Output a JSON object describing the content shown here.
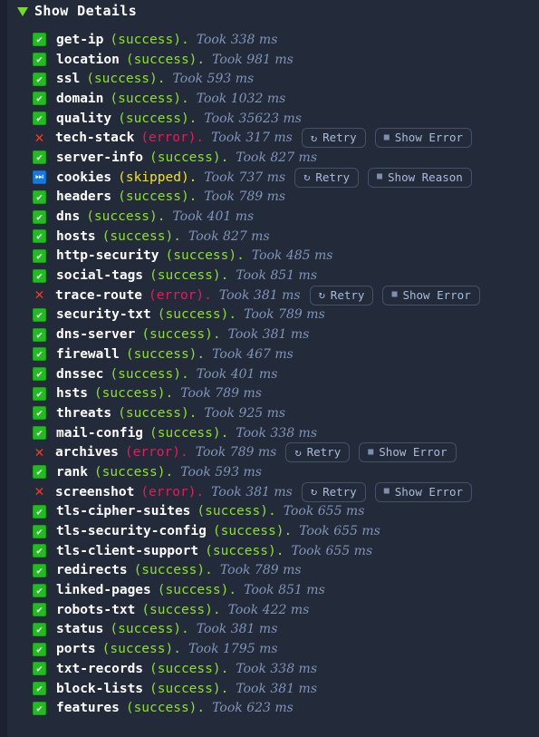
{
  "header": {
    "toggle_icon": "triangle-down-icon",
    "title": "Show Details"
  },
  "buttons": {
    "retry_label": "Retry",
    "retry_icon": "rotate-ccw-icon",
    "retry_glyph": "↻",
    "show_error_label": "Show Error",
    "show_reason_label": "Show Reason",
    "square_icon": "square-icon",
    "square_glyph": "■"
  },
  "colors": {
    "background": "#232a3a",
    "gutter": "#1b2130",
    "success": "#8ce02a",
    "error": "#e81a5c",
    "skipped": "#f2e515",
    "error_mark": "#e8412a",
    "badge_success_bg": "#22bb22",
    "badge_skipped_bg": "#1779e0",
    "took_text": "#8094b8",
    "name_text": "#ffffff",
    "button_border": "#45506b",
    "button_text": "#a9bbdb",
    "triangle": "#74dd23"
  },
  "jobs": [
    {
      "name": "get-ip",
      "status": "success",
      "status_label": "(success).",
      "took": "Took 338 ms",
      "actions": []
    },
    {
      "name": "location",
      "status": "success",
      "status_label": "(success).",
      "took": "Took 981 ms",
      "actions": []
    },
    {
      "name": "ssl",
      "status": "success",
      "status_label": "(success).",
      "took": "Took 593 ms",
      "actions": []
    },
    {
      "name": "domain",
      "status": "success",
      "status_label": "(success).",
      "took": "Took 1032 ms",
      "actions": []
    },
    {
      "name": "quality",
      "status": "success",
      "status_label": "(success).",
      "took": "Took 35623 ms",
      "actions": []
    },
    {
      "name": "tech-stack",
      "status": "error",
      "status_label": "(error).",
      "took": "Took 317 ms",
      "actions": [
        "Retry",
        "Show Error"
      ]
    },
    {
      "name": "server-info",
      "status": "success",
      "status_label": "(success).",
      "took": "Took 827 ms",
      "actions": []
    },
    {
      "name": "cookies",
      "status": "skipped",
      "status_label": "(skipped).",
      "took": "Took 737 ms",
      "actions": [
        "Retry",
        "Show Reason"
      ]
    },
    {
      "name": "headers",
      "status": "success",
      "status_label": "(success).",
      "took": "Took 789 ms",
      "actions": []
    },
    {
      "name": "dns",
      "status": "success",
      "status_label": "(success).",
      "took": "Took 401 ms",
      "actions": []
    },
    {
      "name": "hosts",
      "status": "success",
      "status_label": "(success).",
      "took": "Took 827 ms",
      "actions": []
    },
    {
      "name": "http-security",
      "status": "success",
      "status_label": "(success).",
      "took": "Took 485 ms",
      "actions": []
    },
    {
      "name": "social-tags",
      "status": "success",
      "status_label": "(success).",
      "took": "Took 851 ms",
      "actions": []
    },
    {
      "name": "trace-route",
      "status": "error",
      "status_label": "(error).",
      "took": "Took 381 ms",
      "actions": [
        "Retry",
        "Show Error"
      ]
    },
    {
      "name": "security-txt",
      "status": "success",
      "status_label": "(success).",
      "took": "Took 789 ms",
      "actions": []
    },
    {
      "name": "dns-server",
      "status": "success",
      "status_label": "(success).",
      "took": "Took 381 ms",
      "actions": []
    },
    {
      "name": "firewall",
      "status": "success",
      "status_label": "(success).",
      "took": "Took 467 ms",
      "actions": []
    },
    {
      "name": "dnssec",
      "status": "success",
      "status_label": "(success).",
      "took": "Took 401 ms",
      "actions": []
    },
    {
      "name": "hsts",
      "status": "success",
      "status_label": "(success).",
      "took": "Took 789 ms",
      "actions": []
    },
    {
      "name": "threats",
      "status": "success",
      "status_label": "(success).",
      "took": "Took 925 ms",
      "actions": []
    },
    {
      "name": "mail-config",
      "status": "success",
      "status_label": "(success).",
      "took": "Took 338 ms",
      "actions": []
    },
    {
      "name": "archives",
      "status": "error",
      "status_label": "(error).",
      "took": "Took 789 ms",
      "actions": [
        "Retry",
        "Show Error"
      ]
    },
    {
      "name": "rank",
      "status": "success",
      "status_label": "(success).",
      "took": "Took 593 ms",
      "actions": []
    },
    {
      "name": "screenshot",
      "status": "error",
      "status_label": "(error).",
      "took": "Took 381 ms",
      "actions": [
        "Retry",
        "Show Error"
      ]
    },
    {
      "name": "tls-cipher-suites",
      "status": "success",
      "status_label": "(success).",
      "took": "Took 655 ms",
      "actions": []
    },
    {
      "name": "tls-security-config",
      "status": "success",
      "status_label": "(success).",
      "took": "Took 655 ms",
      "actions": []
    },
    {
      "name": "tls-client-support",
      "status": "success",
      "status_label": "(success).",
      "took": "Took 655 ms",
      "actions": []
    },
    {
      "name": "redirects",
      "status": "success",
      "status_label": "(success).",
      "took": "Took 789 ms",
      "actions": []
    },
    {
      "name": "linked-pages",
      "status": "success",
      "status_label": "(success).",
      "took": "Took 851 ms",
      "actions": []
    },
    {
      "name": "robots-txt",
      "status": "success",
      "status_label": "(success).",
      "took": "Took 422 ms",
      "actions": []
    },
    {
      "name": "status",
      "status": "success",
      "status_label": "(success).",
      "took": "Took 381 ms",
      "actions": []
    },
    {
      "name": "ports",
      "status": "success",
      "status_label": "(success).",
      "took": "Took 1795 ms",
      "actions": []
    },
    {
      "name": "txt-records",
      "status": "success",
      "status_label": "(success).",
      "took": "Took 338 ms",
      "actions": []
    },
    {
      "name": "block-lists",
      "status": "success",
      "status_label": "(success).",
      "took": "Took 381 ms",
      "actions": []
    },
    {
      "name": "features",
      "status": "success",
      "status_label": "(success).",
      "took": "Took 623 ms",
      "actions": []
    }
  ]
}
